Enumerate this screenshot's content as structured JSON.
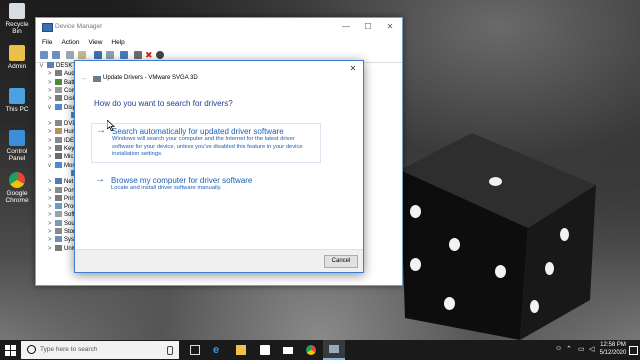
{
  "desktop": {
    "icons": [
      {
        "label": "Recycle Bin",
        "color": "#d8dde3"
      },
      {
        "label": "Admin",
        "color": "#e9c04a"
      },
      {
        "label": "This PC",
        "color": "#4aa3e0"
      },
      {
        "label": "Control Panel",
        "color": "#3b8ed8"
      },
      {
        "label": "Google Chrome",
        "color": "#e0493a"
      }
    ]
  },
  "device_manager": {
    "title": "Device Manager",
    "menu": [
      "File",
      "Action",
      "View",
      "Help"
    ],
    "tree": [
      {
        "chevron": "v",
        "label": "DESKTO"
      },
      {
        "chevron": ">",
        "label": "Aud"
      },
      {
        "chevron": ">",
        "label": "Batt"
      },
      {
        "chevron": ">",
        "label": "Com"
      },
      {
        "chevron": ">",
        "label": "Disk"
      },
      {
        "chevron": "v",
        "label": "Disp"
      },
      {
        "chevron": "",
        "label": ""
      },
      {
        "chevron": ">",
        "label": "DVD"
      },
      {
        "chevron": ">",
        "label": "Hum"
      },
      {
        "chevron": ">",
        "label": "IDE"
      },
      {
        "chevron": ">",
        "label": "Key"
      },
      {
        "chevron": ">",
        "label": "Mic"
      },
      {
        "chevron": "v",
        "label": "Mon"
      },
      {
        "chevron": "",
        "label": ""
      },
      {
        "chevron": ">",
        "label": "Net"
      },
      {
        "chevron": ">",
        "label": "Port"
      },
      {
        "chevron": ">",
        "label": "Prin"
      },
      {
        "chevron": ">",
        "label": "Proc"
      },
      {
        "chevron": ">",
        "label": "Soft"
      },
      {
        "chevron": ">",
        "label": "Sou"
      },
      {
        "chevron": ">",
        "label": "Stor"
      },
      {
        "chevron": ">",
        "label": "Syst"
      },
      {
        "chevron": ">",
        "label": "Univ"
      }
    ]
  },
  "dialog": {
    "title": "Update Drivers - VMware SVGA 3D",
    "heading": "How do you want to search for drivers?",
    "options": [
      {
        "title": "Search automatically for updated driver software",
        "description": "Windows will search your computer and the Internet for the latest driver software for your device, unless you've disabled this feature in your device installation settings."
      },
      {
        "title": "Browse my computer for driver software",
        "description": "Locate and install driver software manually."
      }
    ],
    "cancel_label": "Cancel",
    "close_glyph": "✕",
    "back_glyph": "←",
    "arrow_glyph": "→"
  },
  "taskbar": {
    "search_placeholder": "Type here to search",
    "time": "12:58 PM",
    "date": "5/12/2020",
    "apps": [
      "task-view",
      "edge",
      "file-explorer",
      "store",
      "mail",
      "chrome",
      "device-manager"
    ]
  }
}
